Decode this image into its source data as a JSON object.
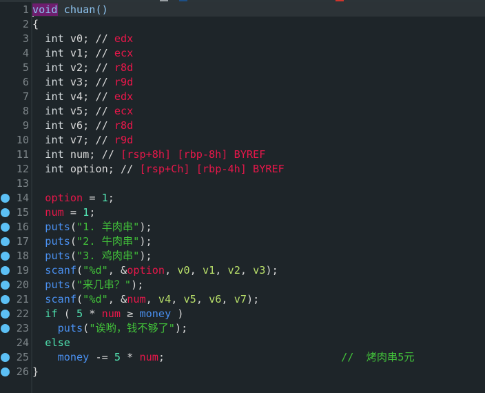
{
  "editor": {
    "function_name": "chuan",
    "breakpoint_color": "#5cc0f5",
    "lines": [
      {
        "n": "1",
        "bp": false
      },
      {
        "n": "2",
        "bp": false
      },
      {
        "n": "3",
        "bp": false
      },
      {
        "n": "4",
        "bp": false
      },
      {
        "n": "5",
        "bp": false
      },
      {
        "n": "6",
        "bp": false
      },
      {
        "n": "7",
        "bp": false
      },
      {
        "n": "8",
        "bp": false
      },
      {
        "n": "9",
        "bp": false
      },
      {
        "n": "10",
        "bp": false
      },
      {
        "n": "11",
        "bp": false
      },
      {
        "n": "12",
        "bp": false
      },
      {
        "n": "13",
        "bp": false
      },
      {
        "n": "14",
        "bp": true
      },
      {
        "n": "15",
        "bp": true
      },
      {
        "n": "16",
        "bp": true
      },
      {
        "n": "17",
        "bp": true
      },
      {
        "n": "18",
        "bp": true
      },
      {
        "n": "19",
        "bp": true
      },
      {
        "n": "20",
        "bp": true
      },
      {
        "n": "21",
        "bp": true
      },
      {
        "n": "22",
        "bp": true
      },
      {
        "n": "23",
        "bp": true
      },
      {
        "n": "24",
        "bp": false
      },
      {
        "n": "25",
        "bp": true
      },
      {
        "n": "26",
        "bp": true
      }
    ],
    "tokens": {
      "void": "void",
      "paren_open_close": "()",
      "brace_open": "{",
      "brace_close": "}",
      "int": "int",
      "cmt": "//",
      "v": [
        "v0",
        "v1",
        "v2",
        "v3",
        "v4",
        "v5",
        "v6",
        "v7"
      ],
      "v_regs": [
        "edx",
        "ecx",
        "r8d",
        "r9d",
        "edx",
        "ecx",
        "r8d",
        "r9d"
      ],
      "num_var": "num",
      "option_var": "option",
      "num_comment": "[rsp+8h] [rbp-8h] BYREF",
      "option_comment": "[rsp+Ch] [rbp-4h] BYREF",
      "puts": "puts",
      "scanf": "scanf",
      "one": "1",
      "five": "5",
      "str1": "\"1. 羊肉串\"",
      "str2": "\"2. 牛肉串\"",
      "str3": "\"3. 鸡肉串\"",
      "fmt": "\"%d\"",
      "str_ask": "\"来几串？\"",
      "str_broke": "\"诶哟，钱不够了\"",
      "if": "if",
      "else": "else",
      "money": "money",
      "ge": "≥",
      "trailing_comment": "//  烤肉串5元"
    }
  }
}
